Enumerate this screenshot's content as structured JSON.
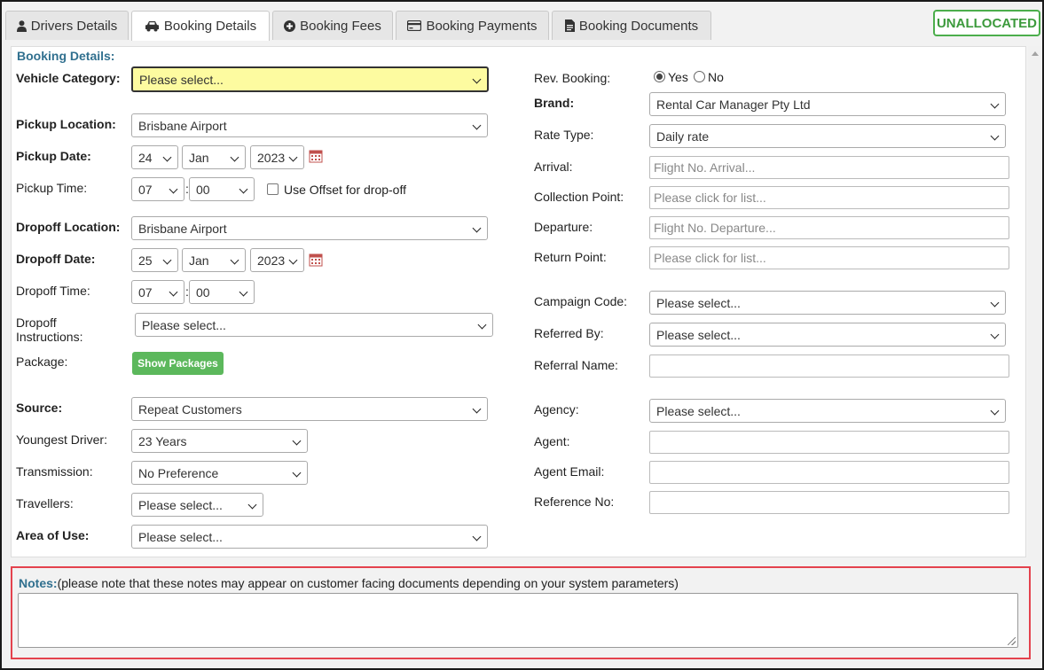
{
  "tabs": [
    {
      "label": "Drivers Details",
      "icon": "user-icon"
    },
    {
      "label": "Booking Details",
      "icon": "car-icon"
    },
    {
      "label": "Booking Fees",
      "icon": "plus-circle-icon"
    },
    {
      "label": "Booking Payments",
      "icon": "credit-card-icon"
    },
    {
      "label": "Booking Documents",
      "icon": "document-icon"
    }
  ],
  "status": "UNALLOCATED",
  "section_title": "Booking Details:",
  "left": {
    "vehicle_category": {
      "label": "Vehicle Category:",
      "value": "Please select..."
    },
    "pickup_location": {
      "label": "Pickup Location:",
      "value": "Brisbane Airport"
    },
    "pickup_date": {
      "label": "Pickup Date:",
      "day": "24",
      "month": "Jan",
      "year": "2023"
    },
    "pickup_time": {
      "label": "Pickup Time:",
      "hour": "07",
      "minute": "00",
      "offset_label": "Use Offset for drop-off"
    },
    "dropoff_location": {
      "label": "Dropoff Location:",
      "value": "Brisbane Airport"
    },
    "dropoff_date": {
      "label": "Dropoff Date:",
      "day": "25",
      "month": "Jan",
      "year": "2023"
    },
    "dropoff_time": {
      "label": "Dropoff Time:",
      "hour": "07",
      "minute": "00"
    },
    "dropoff_instructions": {
      "label_line1": "Dropoff",
      "label_line2": "Instructions:",
      "value": "Please select..."
    },
    "package": {
      "label": "Package:",
      "button": "Show Packages"
    },
    "source": {
      "label": "Source:",
      "value": "Repeat Customers"
    },
    "youngest_driver": {
      "label": "Youngest Driver:",
      "value": "23 Years"
    },
    "transmission": {
      "label": "Transmission:",
      "value": "No Preference"
    },
    "travellers": {
      "label": "Travellers:",
      "value": "Please select..."
    },
    "area_of_use": {
      "label": "Area of Use:",
      "value": "Please select..."
    }
  },
  "right": {
    "rev_booking": {
      "label": "Rev. Booking:",
      "yes": "Yes",
      "no": "No",
      "selected": "Yes"
    },
    "brand": {
      "label": "Brand:",
      "value": "Rental Car Manager Pty Ltd"
    },
    "rate_type": {
      "label": "Rate Type:",
      "value": "Daily rate"
    },
    "arrival": {
      "label": "Arrival:",
      "placeholder": "Flight No. Arrival..."
    },
    "collection_point": {
      "label": "Collection Point:",
      "placeholder": "Please click for list..."
    },
    "departure": {
      "label": "Departure:",
      "placeholder": "Flight No. Departure..."
    },
    "return_point": {
      "label": "Return Point:",
      "placeholder": "Please click for list..."
    },
    "campaign_code": {
      "label": "Campaign Code:",
      "value": "Please select..."
    },
    "referred_by": {
      "label": "Referred By:",
      "value": "Please select..."
    },
    "referral_name": {
      "label": "Referral Name:",
      "value": ""
    },
    "agency": {
      "label": "Agency:",
      "value": "Please select..."
    },
    "agent": {
      "label": "Agent:",
      "value": ""
    },
    "agent_email": {
      "label": "Agent Email:",
      "value": ""
    },
    "reference_no": {
      "label": "Reference No:",
      "value": ""
    }
  },
  "notes": {
    "label": "Notes:",
    "hint": "(please note that these notes may appear on customer facing documents depending on your system parameters)",
    "value": ""
  },
  "colors": {
    "accent": "#31708f",
    "status_green": "#4cae4c",
    "button_green": "#5cb85c",
    "highlight_red": "#e4424d",
    "required_yellow": "#fdfba0"
  }
}
